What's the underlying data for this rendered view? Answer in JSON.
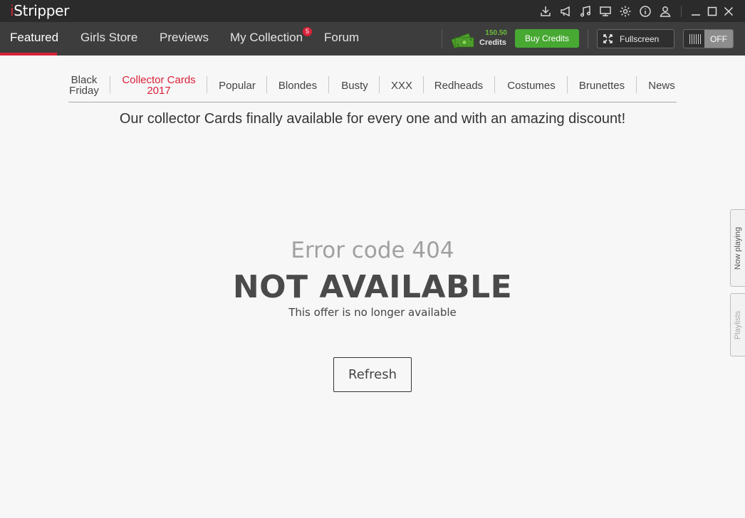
{
  "app": {
    "title_prefix": "i",
    "title_rest": "Stripper"
  },
  "titlebar": {
    "icons": [
      "download-icon",
      "announcement-icon",
      "music-icon",
      "display-icon",
      "settings-icon",
      "info-icon",
      "user-icon"
    ],
    "window_buttons": [
      "minimize-icon",
      "maximize-icon",
      "close-icon"
    ]
  },
  "nav": {
    "items": [
      {
        "label": "Featured"
      },
      {
        "label": "Girls Store"
      },
      {
        "label": "Previews"
      },
      {
        "label": "My Collection"
      },
      {
        "label": "Forum"
      }
    ],
    "collection_badge": "5",
    "credits_amount": "150.50",
    "credits_label": "Credits",
    "buy_label": "Buy Credits",
    "fullscreen_label": "Fullscreen",
    "toggle_state": "OFF"
  },
  "categories": [
    {
      "line1": "Black",
      "line2": "Friday"
    },
    {
      "line1": "Collector Cards",
      "line2": "2017"
    },
    {
      "line1": "Popular"
    },
    {
      "line1": "Blondes"
    },
    {
      "line1": "Busty"
    },
    {
      "line1": "XXX"
    },
    {
      "line1": "Redheads"
    },
    {
      "line1": "Costumes"
    },
    {
      "line1": "Brunettes"
    },
    {
      "line1": "News"
    }
  ],
  "promo_text": "Our collector Cards finally available for every one and with an amazing discount!",
  "error": {
    "code": "Error code 404",
    "title": "NOT AVAILABLE",
    "message": "This offer is no longer available",
    "refresh_label": "Refresh"
  },
  "side_tabs": {
    "now_playing": "Now playing",
    "playlists": "Playlists"
  },
  "colors": {
    "accent": "#d9223a",
    "buy_green": "#47a832",
    "credits_green": "#6dbb3a"
  }
}
